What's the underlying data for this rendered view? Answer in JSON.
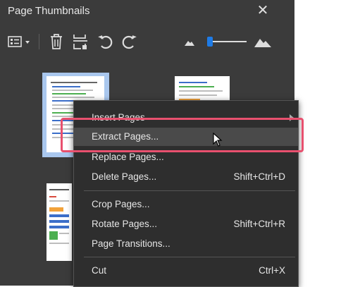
{
  "panel": {
    "title": "Page Thumbnails",
    "close_icon": "close-icon"
  },
  "toolbar": {
    "icons": [
      "options-menu-icon",
      "delete-pages-icon",
      "insert-from-file-icon",
      "undo-rotate-icon",
      "redo-rotate-icon",
      "zoom-out-mountain-icon",
      "zoom-slider",
      "zoom-in-mountain-icon"
    ],
    "zoom_slider_level": 0.0
  },
  "context_menu": {
    "items": [
      {
        "label": "Insert Pages",
        "shortcut": "",
        "submenu": true
      },
      {
        "label": "Extract Pages...",
        "shortcut": ""
      },
      {
        "label": "Replace Pages...",
        "shortcut": ""
      },
      {
        "label": "Delete Pages...",
        "shortcut": "Shift+Ctrl+D"
      },
      {
        "label": "Crop Pages...",
        "shortcut": ""
      },
      {
        "label": "Rotate Pages...",
        "shortcut": "Shift+Ctrl+R"
      },
      {
        "label": "Page Transitions...",
        "shortcut": ""
      },
      {
        "label": "Cut",
        "shortcut": "Ctrl+X"
      }
    ]
  },
  "colors": {
    "panel_bg": "#3b3b3b",
    "menu_bg": "#2e2e2e",
    "highlight": "#e8506e",
    "slider_accent": "#1e7be6"
  }
}
